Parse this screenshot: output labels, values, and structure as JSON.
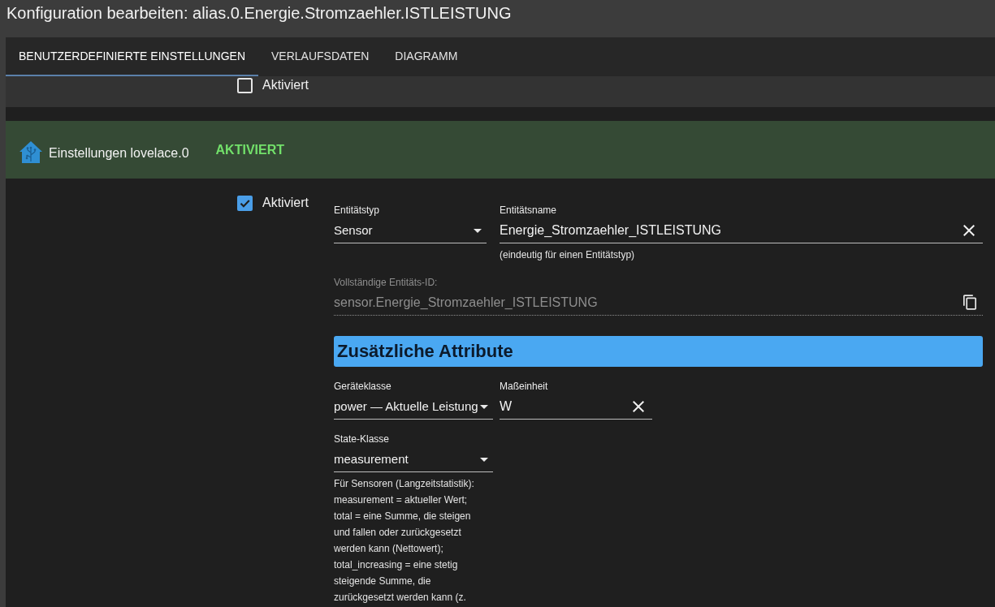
{
  "window": {
    "title": "Konfiguration bearbeiten: alias.0.Energie.Stromzaehler.ISTLEISTUNG"
  },
  "tabs": [
    {
      "label": "BENUTZERDEFINIERTE EINSTELLUNGEN",
      "selected": true
    },
    {
      "label": "VERLAUFSDATEN",
      "selected": false
    },
    {
      "label": "DIAGRAMM",
      "selected": false
    }
  ],
  "previous_section": {
    "checkbox": {
      "label": "Aktiviert",
      "checked": false
    }
  },
  "section": {
    "title": "Einstellungen lovelace.0",
    "status": "AKTIVIERT",
    "checkbox": {
      "label": "Aktiviert",
      "checked": true
    },
    "fields": [
      {
        "kind": "select",
        "label": "Entitätstyp",
        "value": "Sensor"
      },
      {
        "kind": "text",
        "label": "Entitätsname",
        "value": "Energie_Stromzaehler_ISTLEISTUNG",
        "helper": "(eindeutig für einen Entitätstyp)"
      }
    ],
    "entity_id": {
      "kind": "readonly",
      "label": "Vollständige Entitäts-ID:",
      "value": "sensor.Energie_Stromzaehler_ISTLEISTUNG"
    },
    "attributes": {
      "title": "Zusätzliche Attribute",
      "fields": [
        {
          "kind": "select",
          "label": "Geräteklasse",
          "value": "power — Aktuelle Leistung"
        },
        {
          "kind": "text",
          "label": "Maßeinheit",
          "value": "W"
        },
        {
          "kind": "select",
          "label": "State-Klasse",
          "value": "measurement",
          "helper": "Für Sensoren (Langzeitstatistik): measurement = aktueller Wert; total = eine Summe, die steigen und fallen oder zurückgesetzt werden kann (Nettowert); total_increasing = eine stetig steigende Summe, die zurückgesetzt werden kann (z."
        }
      ]
    }
  }
}
